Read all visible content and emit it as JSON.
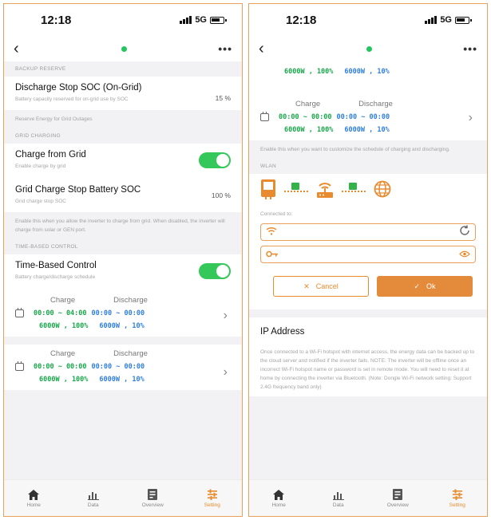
{
  "left": {
    "status": {
      "time": "12:18",
      "network": "5G"
    },
    "sections": {
      "backup_reserve": "BACKUP RESERVE",
      "grid_charging": "GRID CHARGING",
      "time_based_control": "TIME-BASED CONTROL"
    },
    "discharge_stop": {
      "title": "Discharge Stop SOC (On-Grid)",
      "sub": "Battery capacity reserved for on-grid use by SOC",
      "value": "15 %"
    },
    "reserve_note": "Reserve Energy for Grid Outages",
    "charge_from_grid": {
      "title": "Charge from Grid",
      "sub": "Enable charge by grid",
      "enabled": true
    },
    "grid_charge_stop": {
      "title": "Grid Charge Stop Battery SOC",
      "sub": "Grid charge stop SOC",
      "value": "100 %"
    },
    "grid_note": "Enable this when you allow the inverter to charge from grid. When disabled, the inverter will charge from solar or GEN port.",
    "time_based": {
      "title": "Time-Based Control",
      "sub": "Battery charge/discharge schedule",
      "enabled": true
    },
    "schedules": [
      {
        "charge_label": "Charge",
        "discharge_label": "Discharge",
        "charge_range": "00:00 ~ 04:00",
        "discharge_range": "00:00 ~ 00:00",
        "charge_power": "6000W , 100%",
        "discharge_power": "6000W , 10%"
      },
      {
        "charge_label": "Charge",
        "discharge_label": "Discharge",
        "charge_range": "00:00 ~ 00:00",
        "discharge_range": "00:00 ~ 00:00",
        "charge_power": "6000W , 100%",
        "discharge_power": "6000W , 10%"
      }
    ]
  },
  "right": {
    "status": {
      "time": "12:18",
      "network": "5G"
    },
    "partial_schedule": {
      "charge_power": "6000W , 100%",
      "discharge_power": "6000W , 10%"
    },
    "schedule": {
      "charge_label": "Charge",
      "discharge_label": "Discharge",
      "charge_range": "00:00 ~ 00:00",
      "discharge_range": "00:00 ~ 00:00",
      "charge_power": "6000W , 100%",
      "discharge_power": "6000W , 10%"
    },
    "schedule_note": "Enable this when you want to customize the schedule of charging and discharging.",
    "wlan_label": "WLAN",
    "connected_to": "Connected to:",
    "ssid_value": "",
    "password_value": "",
    "cancel_label": "Cancel",
    "ok_label": "Ok",
    "ip_title": "IP Address",
    "ip_note": "Once connected to a Wi-Fi hotspot with internet access, the energy data can be backed up to the cloud server and notified if the inverter fails. NOTE: The inverter will be offline once an incorrect Wi-Fi hotspot name or password is set in remote mode. You will need to reset it at home by connecting the inverter via Bluetooth. (Note: Dongle Wi-Fi network setting: Support 2.4G frequency band only)"
  },
  "tabs": [
    {
      "label": "Home",
      "icon": "home-icon"
    },
    {
      "label": "Data",
      "icon": "chart-icon"
    },
    {
      "label": "Overview",
      "icon": "overview-icon"
    },
    {
      "label": "Setting",
      "icon": "setting-icon",
      "active": true
    }
  ],
  "colors": {
    "accent": "#e88b2e",
    "toggle_on": "#34c759",
    "charge_green": "#19a84a",
    "discharge_blue": "#2f7fe0"
  }
}
